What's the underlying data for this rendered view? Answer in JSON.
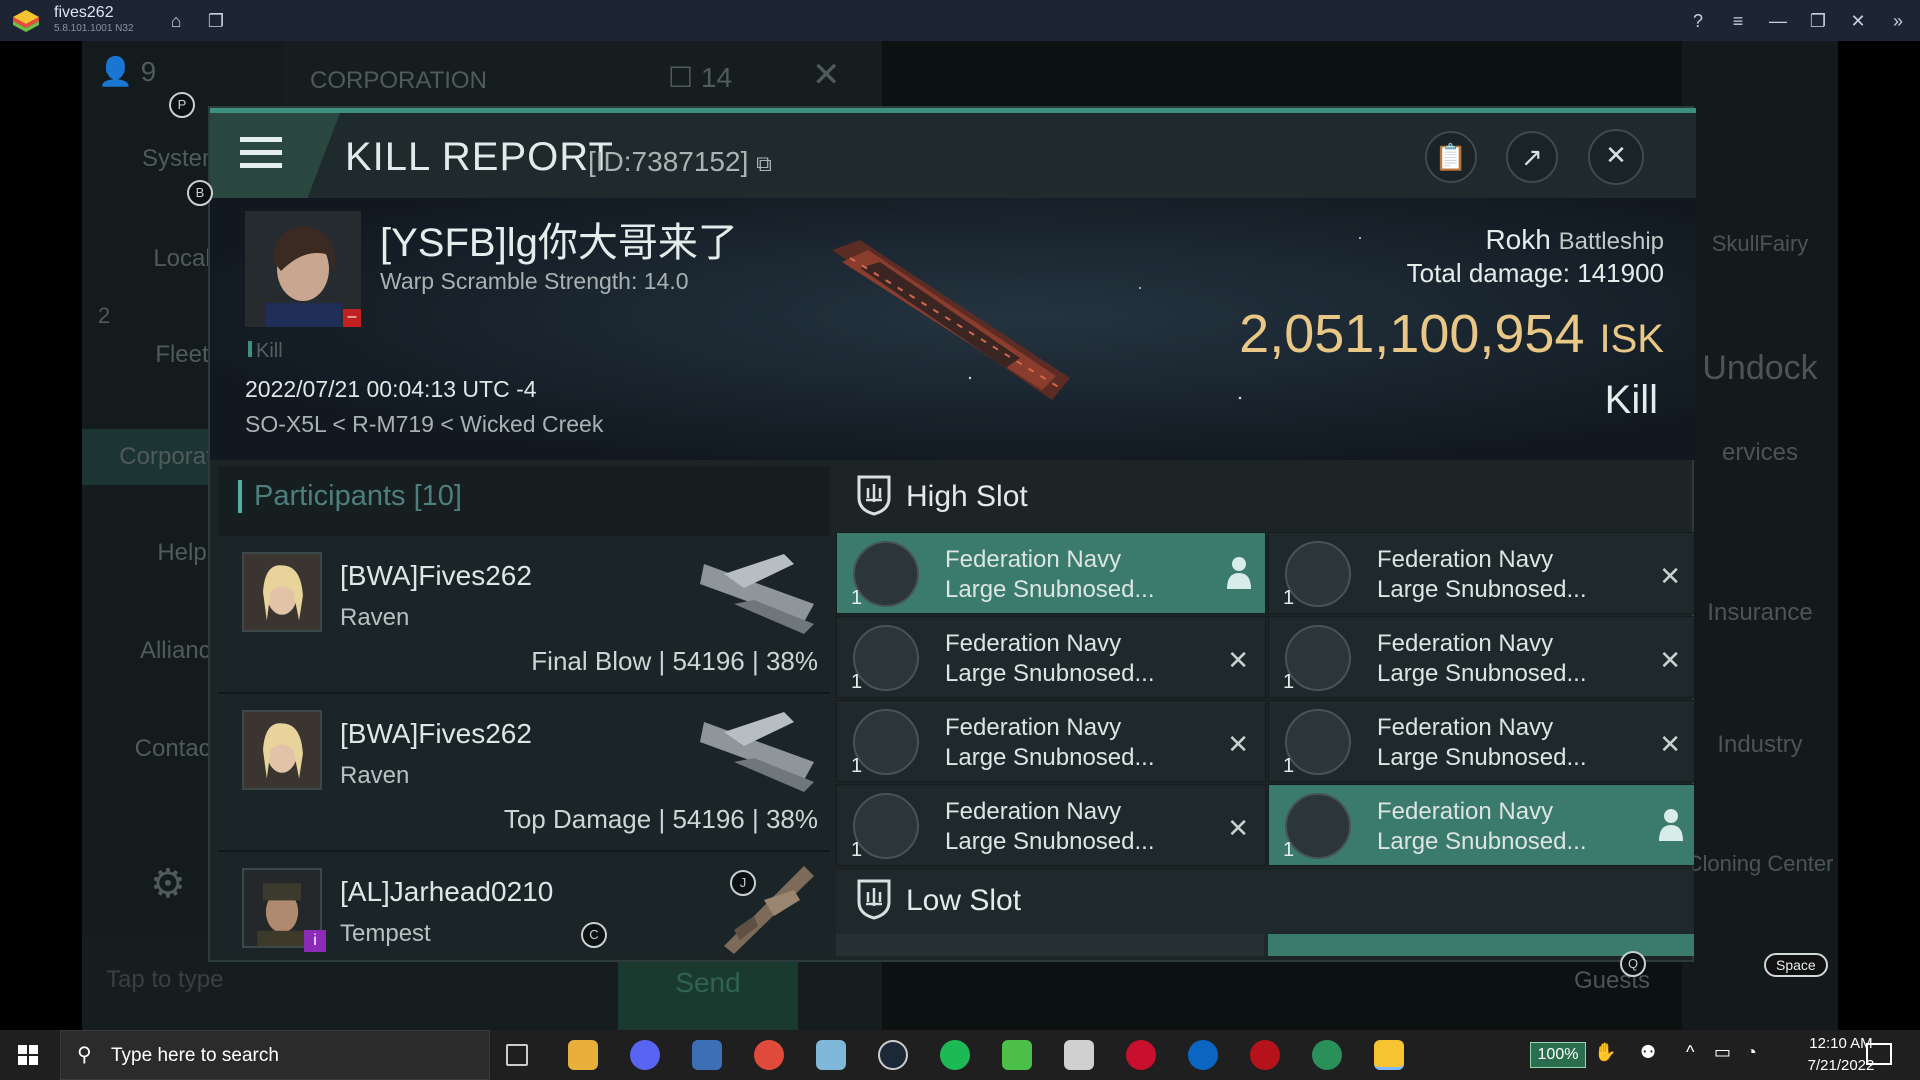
{
  "emulator": {
    "title": "fives262",
    "version": "5.8.101.1001 N32",
    "icons": [
      "home-icon",
      "multi-instance-icon",
      "help-icon",
      "menu-icon",
      "minimize-icon",
      "restore-icon",
      "close-icon",
      "collapse-icon"
    ]
  },
  "background": {
    "player_count": "9",
    "corporation_label": "CORPORATION",
    "corp_count": "14",
    "nav": [
      "System",
      "Local",
      "Fleet",
      "Corporation",
      "Help",
      "Alliance",
      "Contacts"
    ],
    "fleet_badge": "2",
    "chat_placeholder": "Tap to type",
    "send_label": "Send",
    "right": [
      "SkullFairy",
      "Undock",
      "ervices",
      "Insurance",
      "Industry",
      "Cloning Center",
      "Guests"
    ],
    "space_key": "Space"
  },
  "kill_report": {
    "title": "KILL REPORT",
    "id": "[ID:7387152]",
    "victim": {
      "name": "[YSFB]lg你大哥来了",
      "warp": "Warp Scramble Strength: 14.0",
      "tag": "Kill",
      "date": "2022/07/21 00:04:13 UTC -4",
      "location": "SO-X5L < R-M719 < Wicked Creek"
    },
    "ship": {
      "name": "Rokh",
      "class": "Battleship",
      "total_damage_label": "Total damage:",
      "total_damage": "141900",
      "isk_value": "2,051,100,954",
      "isk_unit": "ISK",
      "kill_type": "Kill"
    },
    "participants": {
      "label": "Participants",
      "count": "[10]",
      "rows": [
        {
          "name": "[BWA]Fives262",
          "ship": "Raven",
          "role": "Final Blow",
          "damage": "54196",
          "percent": "38%"
        },
        {
          "name": "[BWA]Fives262",
          "ship": "Raven",
          "role": "Top Damage",
          "damage": "54196",
          "percent": "38%"
        },
        {
          "name": "[AL]Jarhead0210",
          "ship": "Tempest",
          "role": "",
          "damage": "",
          "percent": ""
        }
      ]
    },
    "high_slot": {
      "label": "High Slot",
      "modules": [
        {
          "line1": "Federation Navy",
          "line2": "Large Snubnosed...",
          "qty": "1",
          "state": "fitted"
        },
        {
          "line1": "Federation Navy",
          "line2": "Large Snubnosed...",
          "qty": "1",
          "state": "destroyed"
        },
        {
          "line1": "Federation Navy",
          "line2": "Large Snubnosed...",
          "qty": "1",
          "state": "destroyed"
        },
        {
          "line1": "Federation Navy",
          "line2": "Large Snubnosed...",
          "qty": "1",
          "state": "destroyed"
        },
        {
          "line1": "Federation Navy",
          "line2": "Large Snubnosed...",
          "qty": "1",
          "state": "destroyed"
        },
        {
          "line1": "Federation Navy",
          "line2": "Large Snubnosed...",
          "qty": "1",
          "state": "destroyed"
        },
        {
          "line1": "Federation Navy",
          "line2": "Large Snubnosed...",
          "qty": "1",
          "state": "destroyed"
        },
        {
          "line1": "Federation Navy",
          "line2": "Large Snubnosed...",
          "qty": "1",
          "state": "fitted"
        }
      ]
    },
    "low_slot": {
      "label": "Low Slot"
    }
  },
  "hud_badges": [
    "P",
    "B",
    "J",
    "C",
    "Q"
  ],
  "taskbar": {
    "search_placeholder": "Type here to search",
    "battery": "100%",
    "time": "12:10 AM",
    "date": "7/21/2022"
  },
  "colors": {
    "accent": "#3f8f7e",
    "isk": "#e9c786",
    "fitted": "#3b7b6c"
  }
}
